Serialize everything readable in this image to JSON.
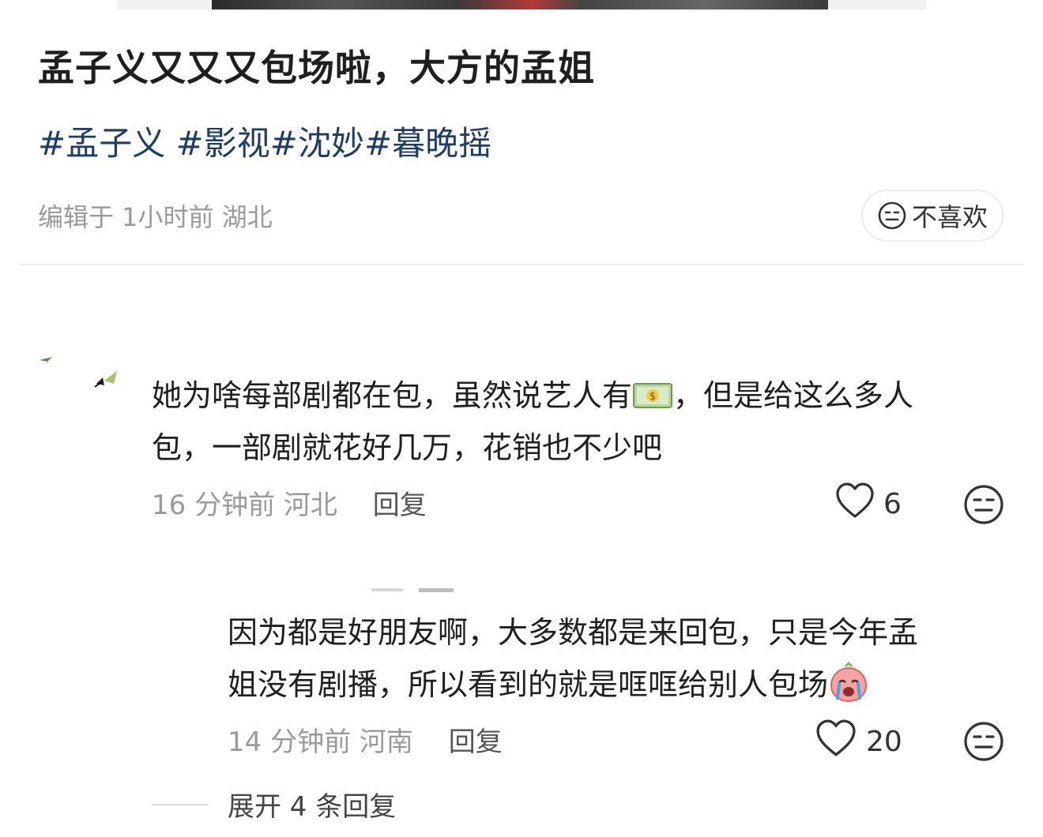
{
  "post": {
    "title": "孟子义又又又包场啦，大方的孟姐",
    "tags": [
      "#孟子义",
      " #影视",
      "#沈妙",
      "#暮晚摇"
    ],
    "meta": "编辑于 1小时前 湖北",
    "dislike_label": "不喜欢"
  },
  "comments": [
    {
      "text_line1_a": "她为啥每部剧都在包，虽然说艺人有",
      "text_line1_b": "，但是给这么多人",
      "text_line2": "包，一部剧就花好几万，花销也不少吧",
      "time": "16 分钟前",
      "location": "河北",
      "reply_label": "回复",
      "likes": "6"
    },
    {
      "text_line1": "因为都是好朋友啊，大多数都是来回包，只是今年孟",
      "text_line2": "姐没有剧播，所以看到的就是哐哐给别人包场",
      "time": "14 分钟前",
      "location": "河南",
      "reply_label": "回复",
      "likes": "20"
    }
  ],
  "expand_label": "展开 4 条回复",
  "colors": {
    "tag": "#1d3d66",
    "meta": "#9a9a9a",
    "text": "#1f1f1f"
  },
  "icons": [
    "neutral-face-icon",
    "heart-icon",
    "money-emoji-icon",
    "crying-emoji-icon"
  ]
}
